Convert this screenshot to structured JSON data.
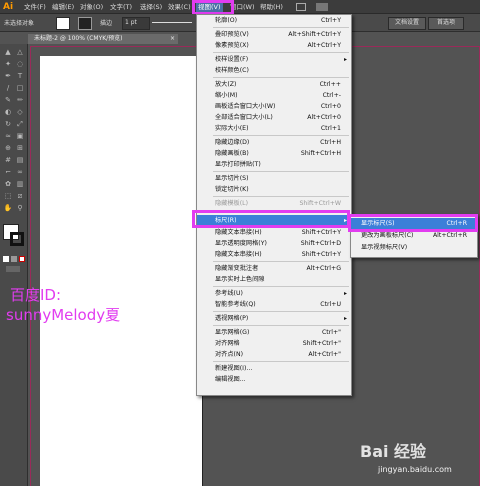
{
  "app": {
    "logo": "Ai"
  },
  "menubar": [
    {
      "label": "文件(F)"
    },
    {
      "label": "编辑(E)"
    },
    {
      "label": "对象(O)"
    },
    {
      "label": "文字(T)"
    },
    {
      "label": "选择(S)"
    },
    {
      "label": "效果(C)"
    },
    {
      "label": "视图(V)"
    },
    {
      "label": "窗口(W)"
    },
    {
      "label": "帮助(H)"
    }
  ],
  "ctrlbar": {
    "selection_label": "未选择对象",
    "stroke_label": "描边",
    "stroke_value": "1 pt",
    "doc_setup": "文档设置",
    "preferences": "首选项"
  },
  "doc_tab": {
    "title": "未标题-2 @ 100% (CMYK/预览)",
    "close": "×"
  },
  "view_menu": [
    {
      "label": "轮廓(O)",
      "shortcut": "Ctrl+Y"
    },
    {
      "label": "叠印预览(V)",
      "shortcut": "Alt+Shift+Ctrl+Y"
    },
    {
      "label": "像素预览(X)",
      "shortcut": "Alt+Ctrl+Y"
    },
    {
      "label": "校样设置(F)",
      "shortcut": ""
    },
    {
      "label": "校样颜色(C)",
      "shortcut": ""
    },
    {
      "label": "放大(Z)",
      "shortcut": "Ctrl++"
    },
    {
      "label": "缩小(M)",
      "shortcut": "Ctrl+-"
    },
    {
      "label": "画板适合窗口大小(W)",
      "shortcut": "Ctrl+0"
    },
    {
      "label": "全部适合窗口大小(L)",
      "shortcut": "Alt+Ctrl+0"
    },
    {
      "label": "实际大小(E)",
      "shortcut": "Ctrl+1"
    },
    {
      "label": "隐藏边缘(D)",
      "shortcut": "Ctrl+H"
    },
    {
      "label": "隐藏画板(B)",
      "shortcut": "Shift+Ctrl+H"
    },
    {
      "label": "显示打印拼贴(T)",
      "shortcut": ""
    },
    {
      "label": "显示切片(S)",
      "shortcut": ""
    },
    {
      "label": "锁定切片(K)",
      "shortcut": ""
    },
    {
      "label": "隐藏模板(L)",
      "shortcut": "Shift+Ctrl+W"
    },
    {
      "label": "标尺(R)",
      "shortcut": ""
    },
    {
      "label": "隐藏文本串接(H)",
      "shortcut": "Shift+Ctrl+Y"
    },
    {
      "label": "显示透明度网格(Y)",
      "shortcut": "Shift+Ctrl+D"
    },
    {
      "label": "隐藏文本串接(H)",
      "shortcut": "Shift+Ctrl+Y"
    },
    {
      "label": "隐藏渐变批注者",
      "shortcut": "Alt+Ctrl+G"
    },
    {
      "label": "显示实时上色间隙",
      "shortcut": ""
    },
    {
      "label": "参考线(U)",
      "shortcut": ""
    },
    {
      "label": "智能参考线(Q)",
      "shortcut": "Ctrl+U"
    },
    {
      "label": "透视网格(P)",
      "shortcut": ""
    },
    {
      "label": "显示网格(G)",
      "shortcut": "Ctrl+\""
    },
    {
      "label": "对齐网格",
      "shortcut": "Shift+Ctrl+\""
    },
    {
      "label": "对齐点(N)",
      "shortcut": "Alt+Ctrl+\""
    },
    {
      "label": "新建视图(I)...",
      "shortcut": ""
    },
    {
      "label": "编辑视图...",
      "shortcut": ""
    }
  ],
  "ruler_submenu": [
    {
      "label": "显示标尺(S)",
      "shortcut": "Ctrl+R"
    },
    {
      "label": "更改为画板标尺(C)",
      "shortcut": "Alt+Ctrl+R"
    },
    {
      "label": "显示视频标尺(V)",
      "shortcut": ""
    }
  ],
  "annotation": {
    "line1": "百度ID:",
    "line2": "sunnyMelody夏"
  },
  "watermark": {
    "brand": "Bai 经验",
    "url": "jingyan.baidu.com"
  },
  "colors": {
    "highlight": "#e23cf0",
    "menu_hover": "#3c7fd8"
  }
}
